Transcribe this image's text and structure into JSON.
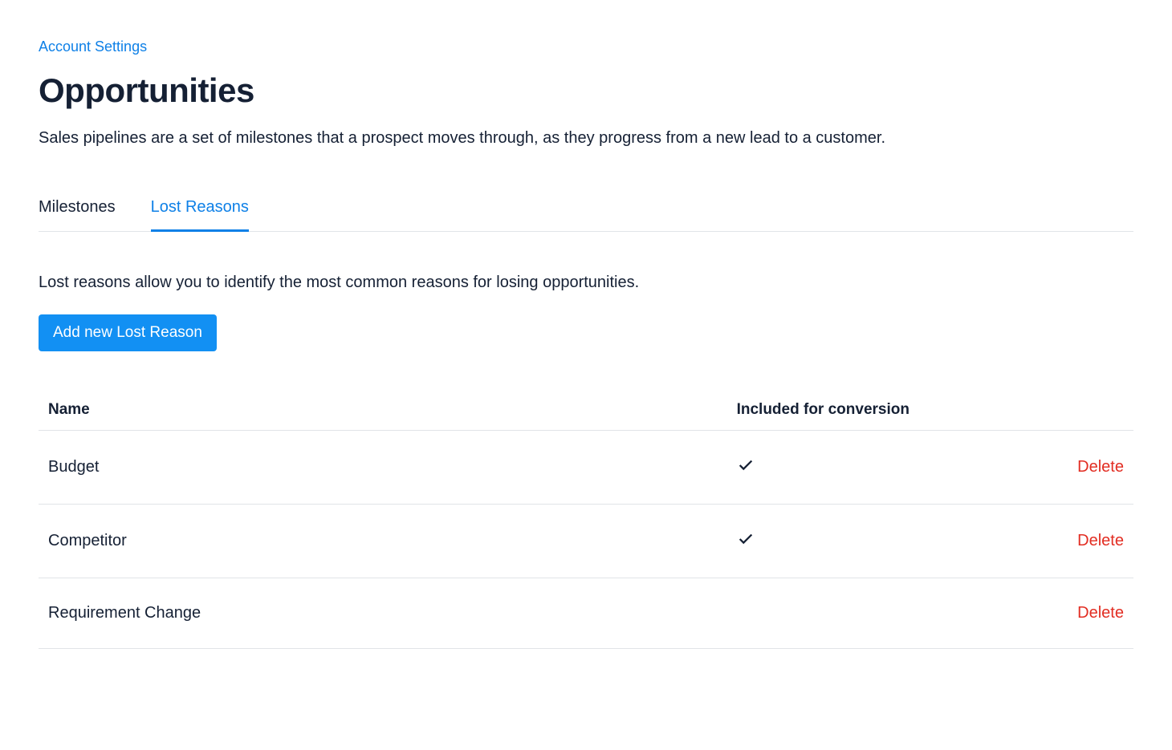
{
  "breadcrumb": {
    "label": "Account Settings"
  },
  "header": {
    "title": "Opportunities",
    "description": "Sales pipelines are a set of milestones that a prospect moves through, as they progress from a new lead to a customer."
  },
  "tabs": [
    {
      "label": "Milestones",
      "active": false
    },
    {
      "label": "Lost Reasons",
      "active": true
    }
  ],
  "section": {
    "description": "Lost reasons allow you to identify the most common reasons for losing opportunities.",
    "add_button_label": "Add new Lost Reason"
  },
  "table": {
    "columns": {
      "name": "Name",
      "included": "Included for conversion"
    },
    "rows": [
      {
        "name": "Budget",
        "included": true,
        "delete_label": "Delete"
      },
      {
        "name": "Competitor",
        "included": true,
        "delete_label": "Delete"
      },
      {
        "name": "Requirement Change",
        "included": false,
        "delete_label": "Delete"
      }
    ]
  }
}
